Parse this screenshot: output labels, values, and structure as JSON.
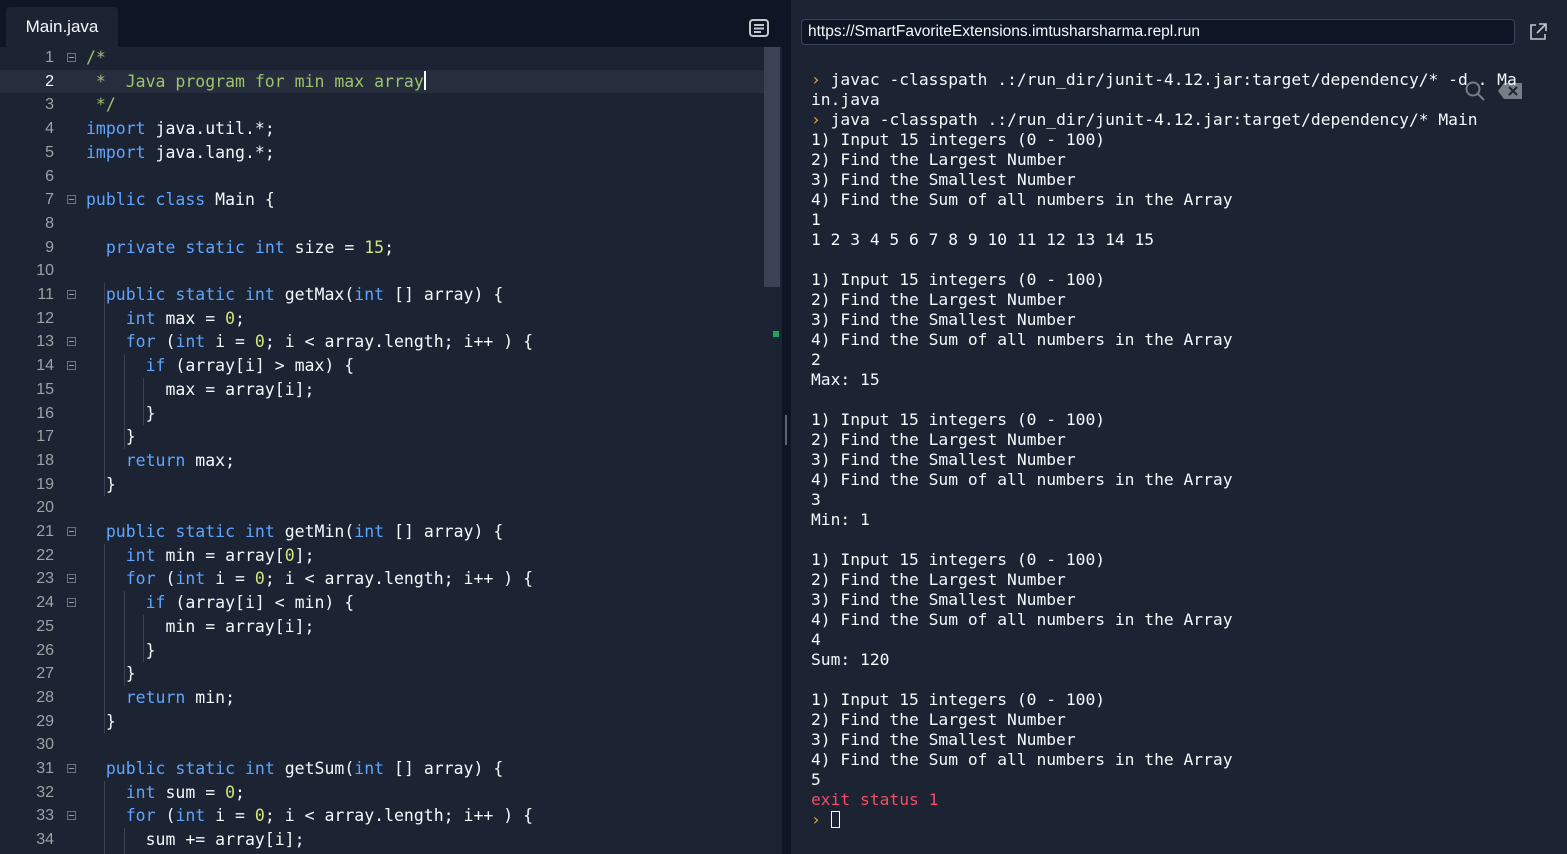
{
  "editor": {
    "active_tab": "Main.java",
    "active_line": 2,
    "lines": [
      {
        "n": "1",
        "fold": true,
        "parts": [
          [
            "c",
            "/*"
          ]
        ]
      },
      {
        "n": "2",
        "fold": false,
        "parts": [
          [
            "c",
            " *  Java program for min max array"
          ]
        ],
        "caret": true
      },
      {
        "n": "3",
        "fold": false,
        "parts": [
          [
            "c",
            " */"
          ]
        ]
      },
      {
        "n": "4",
        "fold": false,
        "parts": [
          [
            "k",
            "import"
          ],
          [
            "t",
            " java.util.*;"
          ]
        ]
      },
      {
        "n": "5",
        "fold": false,
        "parts": [
          [
            "k",
            "import"
          ],
          [
            "t",
            " java.lang.*;"
          ]
        ]
      },
      {
        "n": "6",
        "fold": false,
        "parts": []
      },
      {
        "n": "7",
        "fold": true,
        "parts": [
          [
            "k",
            "public"
          ],
          [
            "t",
            " "
          ],
          [
            "k",
            "class"
          ],
          [
            "t",
            " Main {"
          ]
        ]
      },
      {
        "n": "8",
        "fold": false,
        "parts": []
      },
      {
        "n": "9",
        "fold": false,
        "parts": [
          [
            "t",
            "  "
          ],
          [
            "k",
            "private"
          ],
          [
            "t",
            " "
          ],
          [
            "k",
            "static"
          ],
          [
            "t",
            " "
          ],
          [
            "k",
            "int"
          ],
          [
            "t",
            " size = "
          ],
          [
            "n",
            "15"
          ],
          [
            "t",
            ";"
          ]
        ]
      },
      {
        "n": "10",
        "fold": false,
        "parts": []
      },
      {
        "n": "11",
        "fold": true,
        "parts": [
          [
            "t",
            "  "
          ],
          [
            "k",
            "public"
          ],
          [
            "t",
            " "
          ],
          [
            "k",
            "static"
          ],
          [
            "t",
            " "
          ],
          [
            "k",
            "int"
          ],
          [
            "t",
            " getMax("
          ],
          [
            "k",
            "int"
          ],
          [
            "t",
            " [] array) {"
          ]
        ]
      },
      {
        "n": "12",
        "fold": false,
        "parts": [
          [
            "t",
            "    "
          ],
          [
            "k",
            "int"
          ],
          [
            "t",
            " max = "
          ],
          [
            "n",
            "0"
          ],
          [
            "t",
            ";"
          ]
        ]
      },
      {
        "n": "13",
        "fold": true,
        "parts": [
          [
            "t",
            "    "
          ],
          [
            "k",
            "for"
          ],
          [
            "t",
            " ("
          ],
          [
            "k",
            "int"
          ],
          [
            "t",
            " i = "
          ],
          [
            "n",
            "0"
          ],
          [
            "t",
            "; i < array.length; i++ ) {"
          ]
        ]
      },
      {
        "n": "14",
        "fold": true,
        "parts": [
          [
            "t",
            "      "
          ],
          [
            "k",
            "if"
          ],
          [
            "t",
            " (array[i] > max) {"
          ]
        ]
      },
      {
        "n": "15",
        "fold": false,
        "parts": [
          [
            "t",
            "        max = array[i];"
          ]
        ]
      },
      {
        "n": "16",
        "fold": false,
        "parts": [
          [
            "t",
            "      }"
          ]
        ]
      },
      {
        "n": "17",
        "fold": false,
        "parts": [
          [
            "t",
            "    }"
          ]
        ]
      },
      {
        "n": "18",
        "fold": false,
        "parts": [
          [
            "t",
            "    "
          ],
          [
            "k",
            "return"
          ],
          [
            "t",
            " max;"
          ]
        ]
      },
      {
        "n": "19",
        "fold": false,
        "parts": [
          [
            "t",
            "  }"
          ]
        ]
      },
      {
        "n": "20",
        "fold": false,
        "parts": []
      },
      {
        "n": "21",
        "fold": true,
        "parts": [
          [
            "t",
            "  "
          ],
          [
            "k",
            "public"
          ],
          [
            "t",
            " "
          ],
          [
            "k",
            "static"
          ],
          [
            "t",
            " "
          ],
          [
            "k",
            "int"
          ],
          [
            "t",
            " getMin("
          ],
          [
            "k",
            "int"
          ],
          [
            "t",
            " [] array) {"
          ]
        ]
      },
      {
        "n": "22",
        "fold": false,
        "parts": [
          [
            "t",
            "    "
          ],
          [
            "k",
            "int"
          ],
          [
            "t",
            " min = array["
          ],
          [
            "n",
            "0"
          ],
          [
            "t",
            "];"
          ]
        ]
      },
      {
        "n": "23",
        "fold": true,
        "parts": [
          [
            "t",
            "    "
          ],
          [
            "k",
            "for"
          ],
          [
            "t",
            " ("
          ],
          [
            "k",
            "int"
          ],
          [
            "t",
            " i = "
          ],
          [
            "n",
            "0"
          ],
          [
            "t",
            "; i < array.length; i++ ) {"
          ]
        ]
      },
      {
        "n": "24",
        "fold": true,
        "parts": [
          [
            "t",
            "      "
          ],
          [
            "k",
            "if"
          ],
          [
            "t",
            " (array[i] < min) {"
          ]
        ]
      },
      {
        "n": "25",
        "fold": false,
        "parts": [
          [
            "t",
            "        min = array[i];"
          ]
        ]
      },
      {
        "n": "26",
        "fold": false,
        "parts": [
          [
            "t",
            "      }"
          ]
        ]
      },
      {
        "n": "27",
        "fold": false,
        "parts": [
          [
            "t",
            "    }"
          ]
        ]
      },
      {
        "n": "28",
        "fold": false,
        "parts": [
          [
            "t",
            "    "
          ],
          [
            "k",
            "return"
          ],
          [
            "t",
            " min;"
          ]
        ]
      },
      {
        "n": "29",
        "fold": false,
        "parts": [
          [
            "t",
            "  }"
          ]
        ]
      },
      {
        "n": "30",
        "fold": false,
        "parts": []
      },
      {
        "n": "31",
        "fold": true,
        "parts": [
          [
            "t",
            "  "
          ],
          [
            "k",
            "public"
          ],
          [
            "t",
            " "
          ],
          [
            "k",
            "static"
          ],
          [
            "t",
            " "
          ],
          [
            "k",
            "int"
          ],
          [
            "t",
            " getSum("
          ],
          [
            "k",
            "int"
          ],
          [
            "t",
            " [] array) {"
          ]
        ]
      },
      {
        "n": "32",
        "fold": false,
        "parts": [
          [
            "t",
            "    "
          ],
          [
            "k",
            "int"
          ],
          [
            "t",
            " sum = "
          ],
          [
            "n",
            "0"
          ],
          [
            "t",
            ";"
          ]
        ]
      },
      {
        "n": "33",
        "fold": true,
        "parts": [
          [
            "t",
            "    "
          ],
          [
            "k",
            "for"
          ],
          [
            "t",
            " ("
          ],
          [
            "k",
            "int"
          ],
          [
            "t",
            " i = "
          ],
          [
            "n",
            "0"
          ],
          [
            "t",
            "; i < array.length; i++ ) {"
          ]
        ]
      },
      {
        "n": "34",
        "fold": false,
        "parts": [
          [
            "t",
            "      sum += array[i];"
          ]
        ]
      }
    ]
  },
  "webview": {
    "url": "https://SmartFavoriteExtensions.imtusharsharma.repl.run"
  },
  "console": {
    "prompt_symbol": "›",
    "lines": [
      {
        "type": "cmd",
        "text": "javac -classpath .:/run_dir/junit-4.12.jar:target/dependency/* -d . Ma"
      },
      {
        "type": "out",
        "text": "in.java"
      },
      {
        "type": "cmd",
        "text": "java -classpath .:/run_dir/junit-4.12.jar:target/dependency/* Main"
      },
      {
        "type": "out",
        "text": "1) Input 15 integers (0 - 100)"
      },
      {
        "type": "out",
        "text": "2) Find the Largest Number"
      },
      {
        "type": "out",
        "text": "3) Find the Smallest Number"
      },
      {
        "type": "out",
        "text": "4) Find the Sum of all numbers in the Array"
      },
      {
        "type": "out",
        "text": "1"
      },
      {
        "type": "out",
        "text": "1 2 3 4 5 6 7 8 9 10 11 12 13 14 15"
      },
      {
        "type": "out",
        "text": ""
      },
      {
        "type": "out",
        "text": "1) Input 15 integers (0 - 100)"
      },
      {
        "type": "out",
        "text": "2) Find the Largest Number"
      },
      {
        "type": "out",
        "text": "3) Find the Smallest Number"
      },
      {
        "type": "out",
        "text": "4) Find the Sum of all numbers in the Array"
      },
      {
        "type": "out",
        "text": "2"
      },
      {
        "type": "out",
        "text": "Max: 15"
      },
      {
        "type": "out",
        "text": ""
      },
      {
        "type": "out",
        "text": "1) Input 15 integers (0 - 100)"
      },
      {
        "type": "out",
        "text": "2) Find the Largest Number"
      },
      {
        "type": "out",
        "text": "3) Find the Smallest Number"
      },
      {
        "type": "out",
        "text": "4) Find the Sum of all numbers in the Array"
      },
      {
        "type": "out",
        "text": "3"
      },
      {
        "type": "out",
        "text": "Min: 1"
      },
      {
        "type": "out",
        "text": ""
      },
      {
        "type": "out",
        "text": "1) Input 15 integers (0 - 100)"
      },
      {
        "type": "out",
        "text": "2) Find the Largest Number"
      },
      {
        "type": "out",
        "text": "3) Find the Smallest Number"
      },
      {
        "type": "out",
        "text": "4) Find the Sum of all numbers in the Array"
      },
      {
        "type": "out",
        "text": "4"
      },
      {
        "type": "out",
        "text": "Sum: 120"
      },
      {
        "type": "out",
        "text": ""
      },
      {
        "type": "out",
        "text": "1) Input 15 integers (0 - 100)"
      },
      {
        "type": "out",
        "text": "2) Find the Largest Number"
      },
      {
        "type": "out",
        "text": "3) Find the Smallest Number"
      },
      {
        "type": "out",
        "text": "4) Find the Sum of all numbers in the Array"
      },
      {
        "type": "out",
        "text": "5"
      },
      {
        "type": "err",
        "text": "exit status 1"
      },
      {
        "type": "prompt",
        "text": ""
      }
    ]
  },
  "colors": {
    "keyword": "#5ea5ff",
    "comment": "#9dc36b",
    "number": "#d3e47a",
    "prompt": "#f5a623",
    "error": "#f24e64",
    "background": "#1c2333"
  },
  "icons": {
    "outline": "outline-icon",
    "open_new_tab": "open-in-new-tab-icon",
    "search_console": "search-icon",
    "clear_console": "clear-console-icon"
  }
}
